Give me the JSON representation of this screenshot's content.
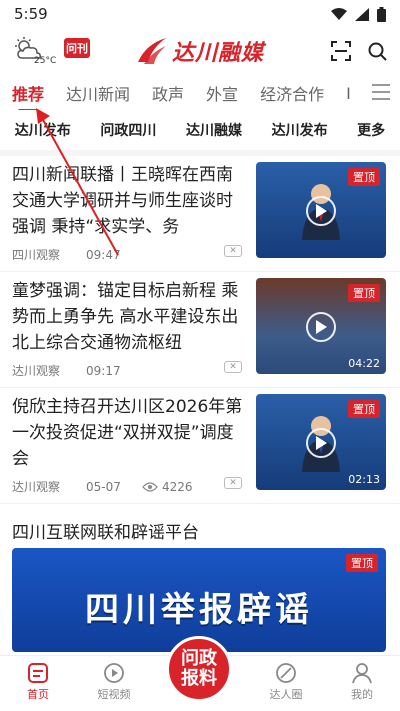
{
  "status_bar": {
    "time": "5:59"
  },
  "header": {
    "weather_icon": "partly-cloudy-icon",
    "temperature": "25°C",
    "badge": "问刊",
    "logo_text": "达川融媒",
    "brand_color": "#d8232a"
  },
  "tabs": {
    "items": [
      "推荐",
      "达川新闻",
      "政声",
      "外宣",
      "经济合作",
      "I"
    ]
  },
  "quick_links": [
    "达川发布",
    "问政四川",
    "达川融媒",
    "达川发布",
    "更多"
  ],
  "news": [
    {
      "title": "四川新闻联播丨王晓晖在西南交通大学调研并与师生座谈时强调 秉持“求实学、务",
      "source": "四川观察",
      "time": "09:47",
      "pin": "置顶"
    },
    {
      "title": "童梦强调：锚定目标启新程 乘势而上勇争先 高水平建设东出北上综合交通物流枢纽",
      "source": "达川观察",
      "time": "09:17",
      "pin": "置顶",
      "duration": "04:22"
    },
    {
      "title": "倪欣主持召开达川区2026年第一次投资促进“双拼双提”调度会",
      "source": "达川观察",
      "time": "05-07",
      "views": "4226",
      "pin": "置顶",
      "duration": "02:13"
    }
  ],
  "section": {
    "title": "四川互联网联和辟谣平台",
    "banner_text": "四川举报辟谣",
    "pin": "置顶"
  },
  "bottom_nav": {
    "home": "首页",
    "short_video": "短视频",
    "center_line1": "问政",
    "center_line2": "报料",
    "talent": "达人圈",
    "mine": "我的"
  }
}
